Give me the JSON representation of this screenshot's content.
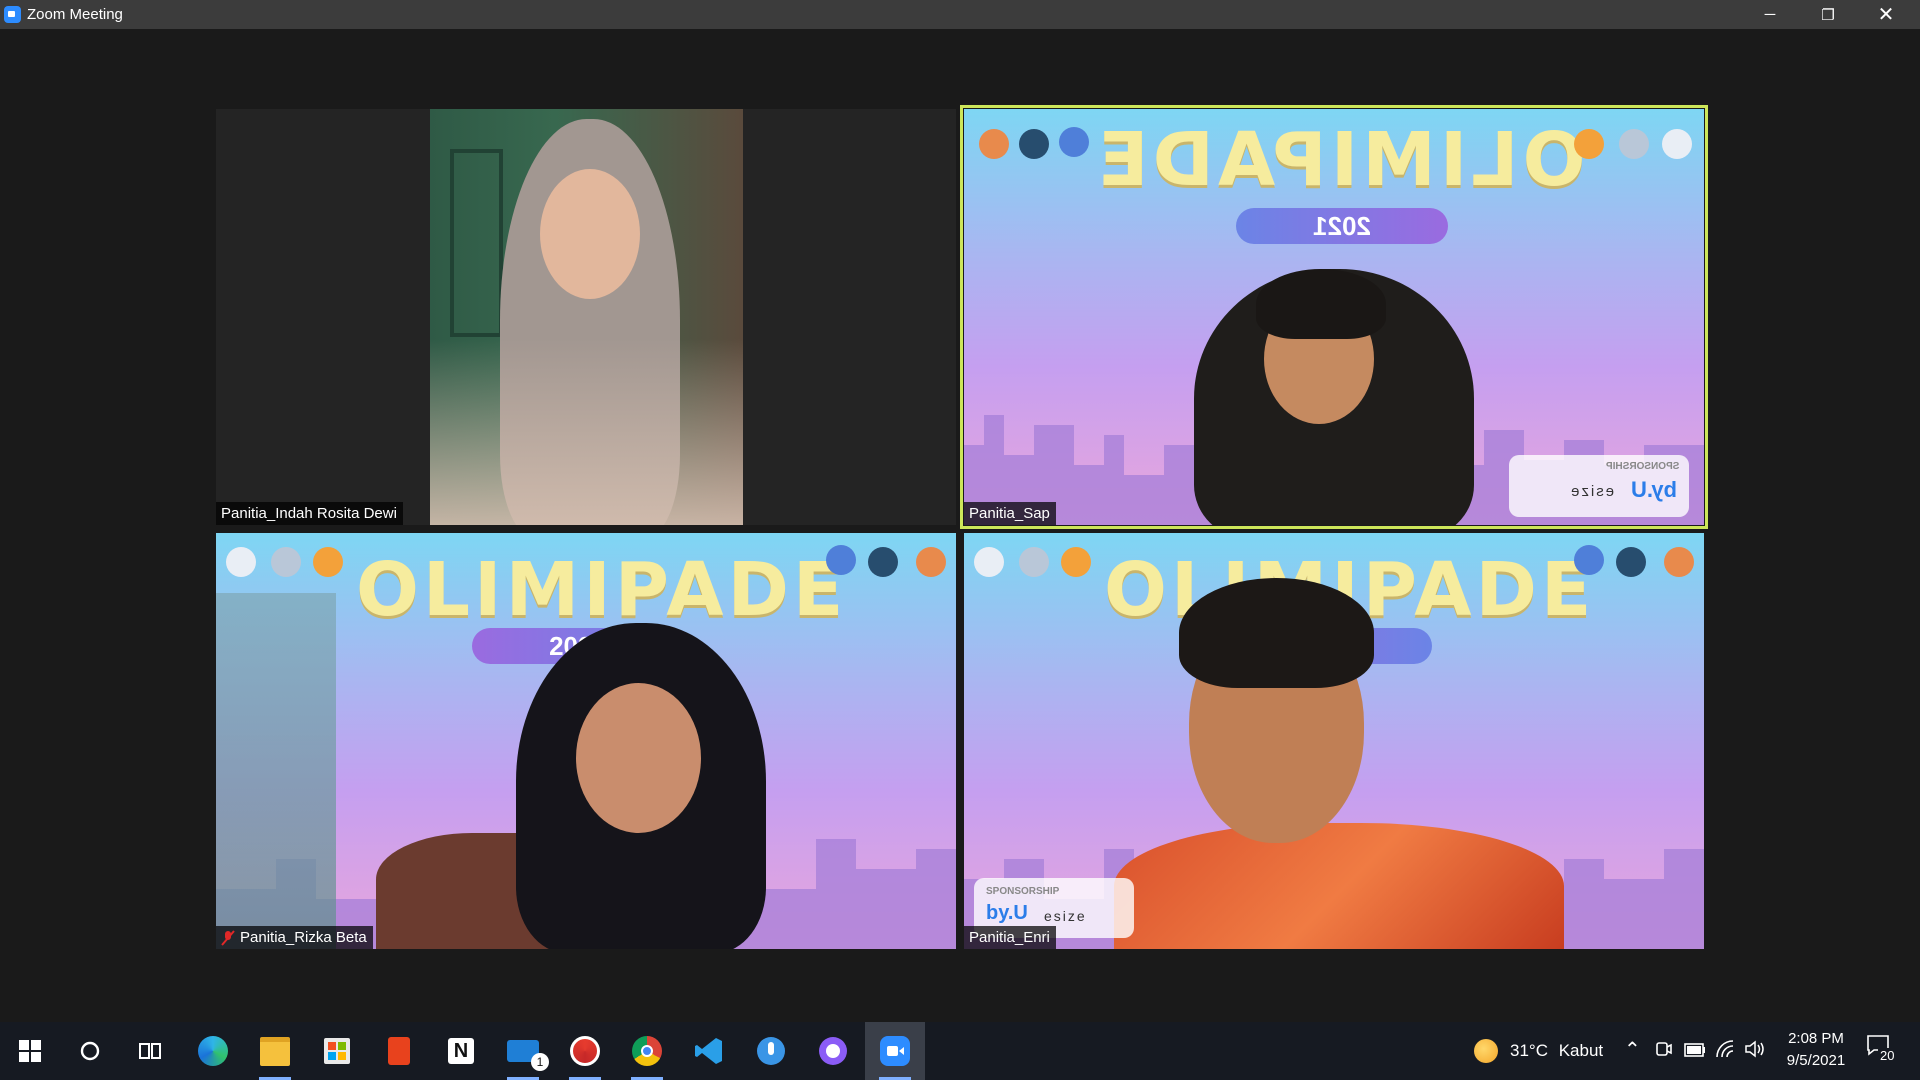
{
  "window": {
    "title": "Zoom Meeting"
  },
  "participants": [
    {
      "name": "Panitia_Indah Rosita Dewi",
      "muted": false
    },
    {
      "name": "Panitia_Sap",
      "muted": false,
      "active_speaker": true
    },
    {
      "name": "Panitia_Rizka Beta",
      "muted": true
    },
    {
      "name": "Panitia_Enri",
      "muted": false
    }
  ],
  "background": {
    "title": "OLIMIPADE",
    "year": "2021",
    "sponsor_label": "SPONSORSHIP",
    "sponsor_brands": [
      "by.U",
      "esize"
    ]
  },
  "taskbar": {
    "weather": {
      "temp": "31°C",
      "desc": "Kabut"
    },
    "time": "2:08 PM",
    "date": "9/5/2021",
    "notification_count": "20",
    "mail_badge": "1",
    "apps": [
      "start-icon",
      "search-icon",
      "task-view-icon",
      "edge-icon",
      "file-explorer-icon",
      "store-icon",
      "office-icon",
      "notion-icon",
      "mail-icon",
      "chrome-red-icon",
      "chrome-icon",
      "vscode-icon",
      "microphone-app-icon",
      "github-icon",
      "zoom-icon"
    ]
  },
  "colors": {
    "speaker_border": "#cde65a",
    "zoom_blue": "#2d8cff",
    "title_yellow": "#f6ec9e"
  }
}
